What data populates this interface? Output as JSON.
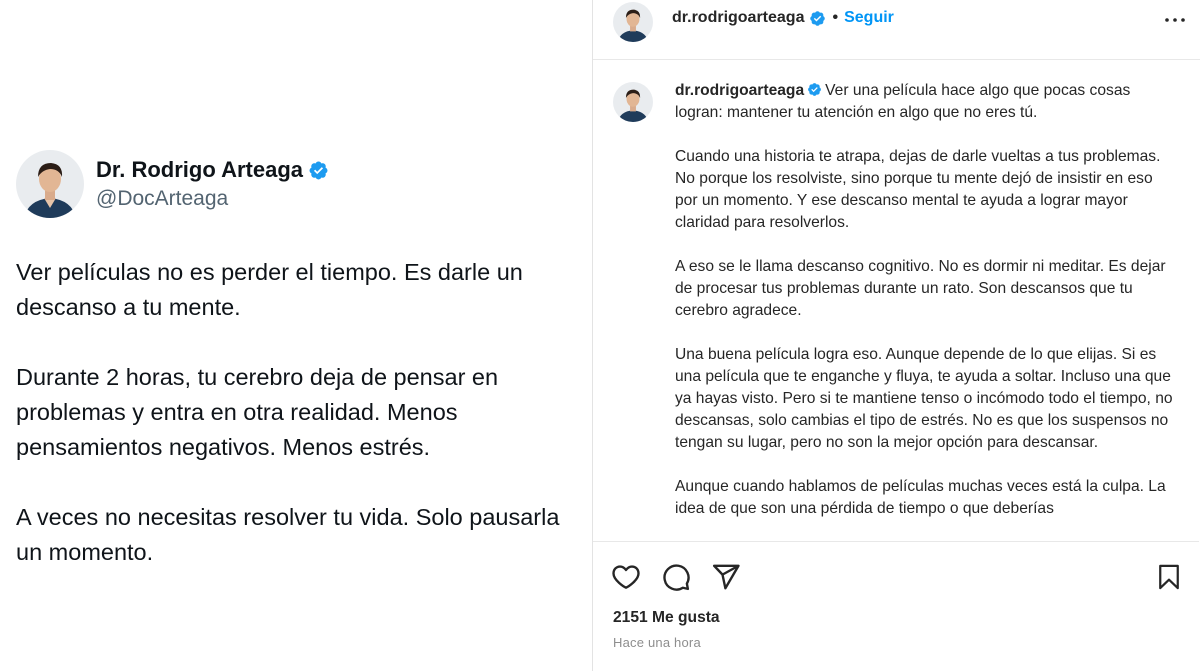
{
  "tweet": {
    "name": "Dr. Rodrigo Arteaga",
    "handle": "@DocArteaga",
    "paragraphs": [
      "Ver películas no es perder el tiempo. Es darle un descanso a tu mente.",
      "Durante 2 horas, tu cerebro deja de pensar en problemas y entra en otra realidad. Menos pensamientos negativos. Menos estrés.",
      "A veces no necesitas resolver tu vida. Solo pausarla un momento."
    ],
    "icons": {
      "avatar": "profile-photo",
      "verified": "verified-badge-icon"
    }
  },
  "instagram": {
    "username": "dr.rodrigoarteaga",
    "dot": "•",
    "follow_label": "Seguir",
    "caption_first": "Ver una película hace algo que pocas cosas logran: mantener tu atención en algo que no eres tú.",
    "caption_paragraphs": [
      "Cuando una historia te atrapa, dejas de darle vueltas a tus problemas. No porque los resolviste, sino porque tu mente dejó de insistir en eso por un momento. Y ese descanso mental te ayuda a lograr mayor claridad para resolverlos.",
      "A eso se le llama descanso cognitivo. No es dormir ni meditar. Es dejar de procesar tus problemas durante un rato. Son descansos que tu cerebro agradece.",
      "Una buena película logra eso. Aunque depende de lo que elijas. Si es una película que te enganche y fluya, te ayuda a soltar. Incluso una que ya hayas visto. Pero si te mantiene tenso o incómodo todo el tiempo, no descansas, solo cambias el tipo de estrés. No es que los suspensos no tengan su lugar, pero no son la mejor opción para descansar.",
      "Aunque cuando hablamos de películas muchas veces está la culpa. La idea de que son una pérdida de tiempo o que deberías"
    ],
    "likes": "2151 Me gusta",
    "time": "Hace una hora",
    "colors": {
      "link": "#0095f6",
      "verified": "#1d9bf0",
      "text": "#262626",
      "muted": "#8e8e8e"
    },
    "icons": [
      "more-options-icon",
      "heart-icon",
      "comment-icon",
      "share-icon",
      "bookmark-icon"
    ]
  }
}
